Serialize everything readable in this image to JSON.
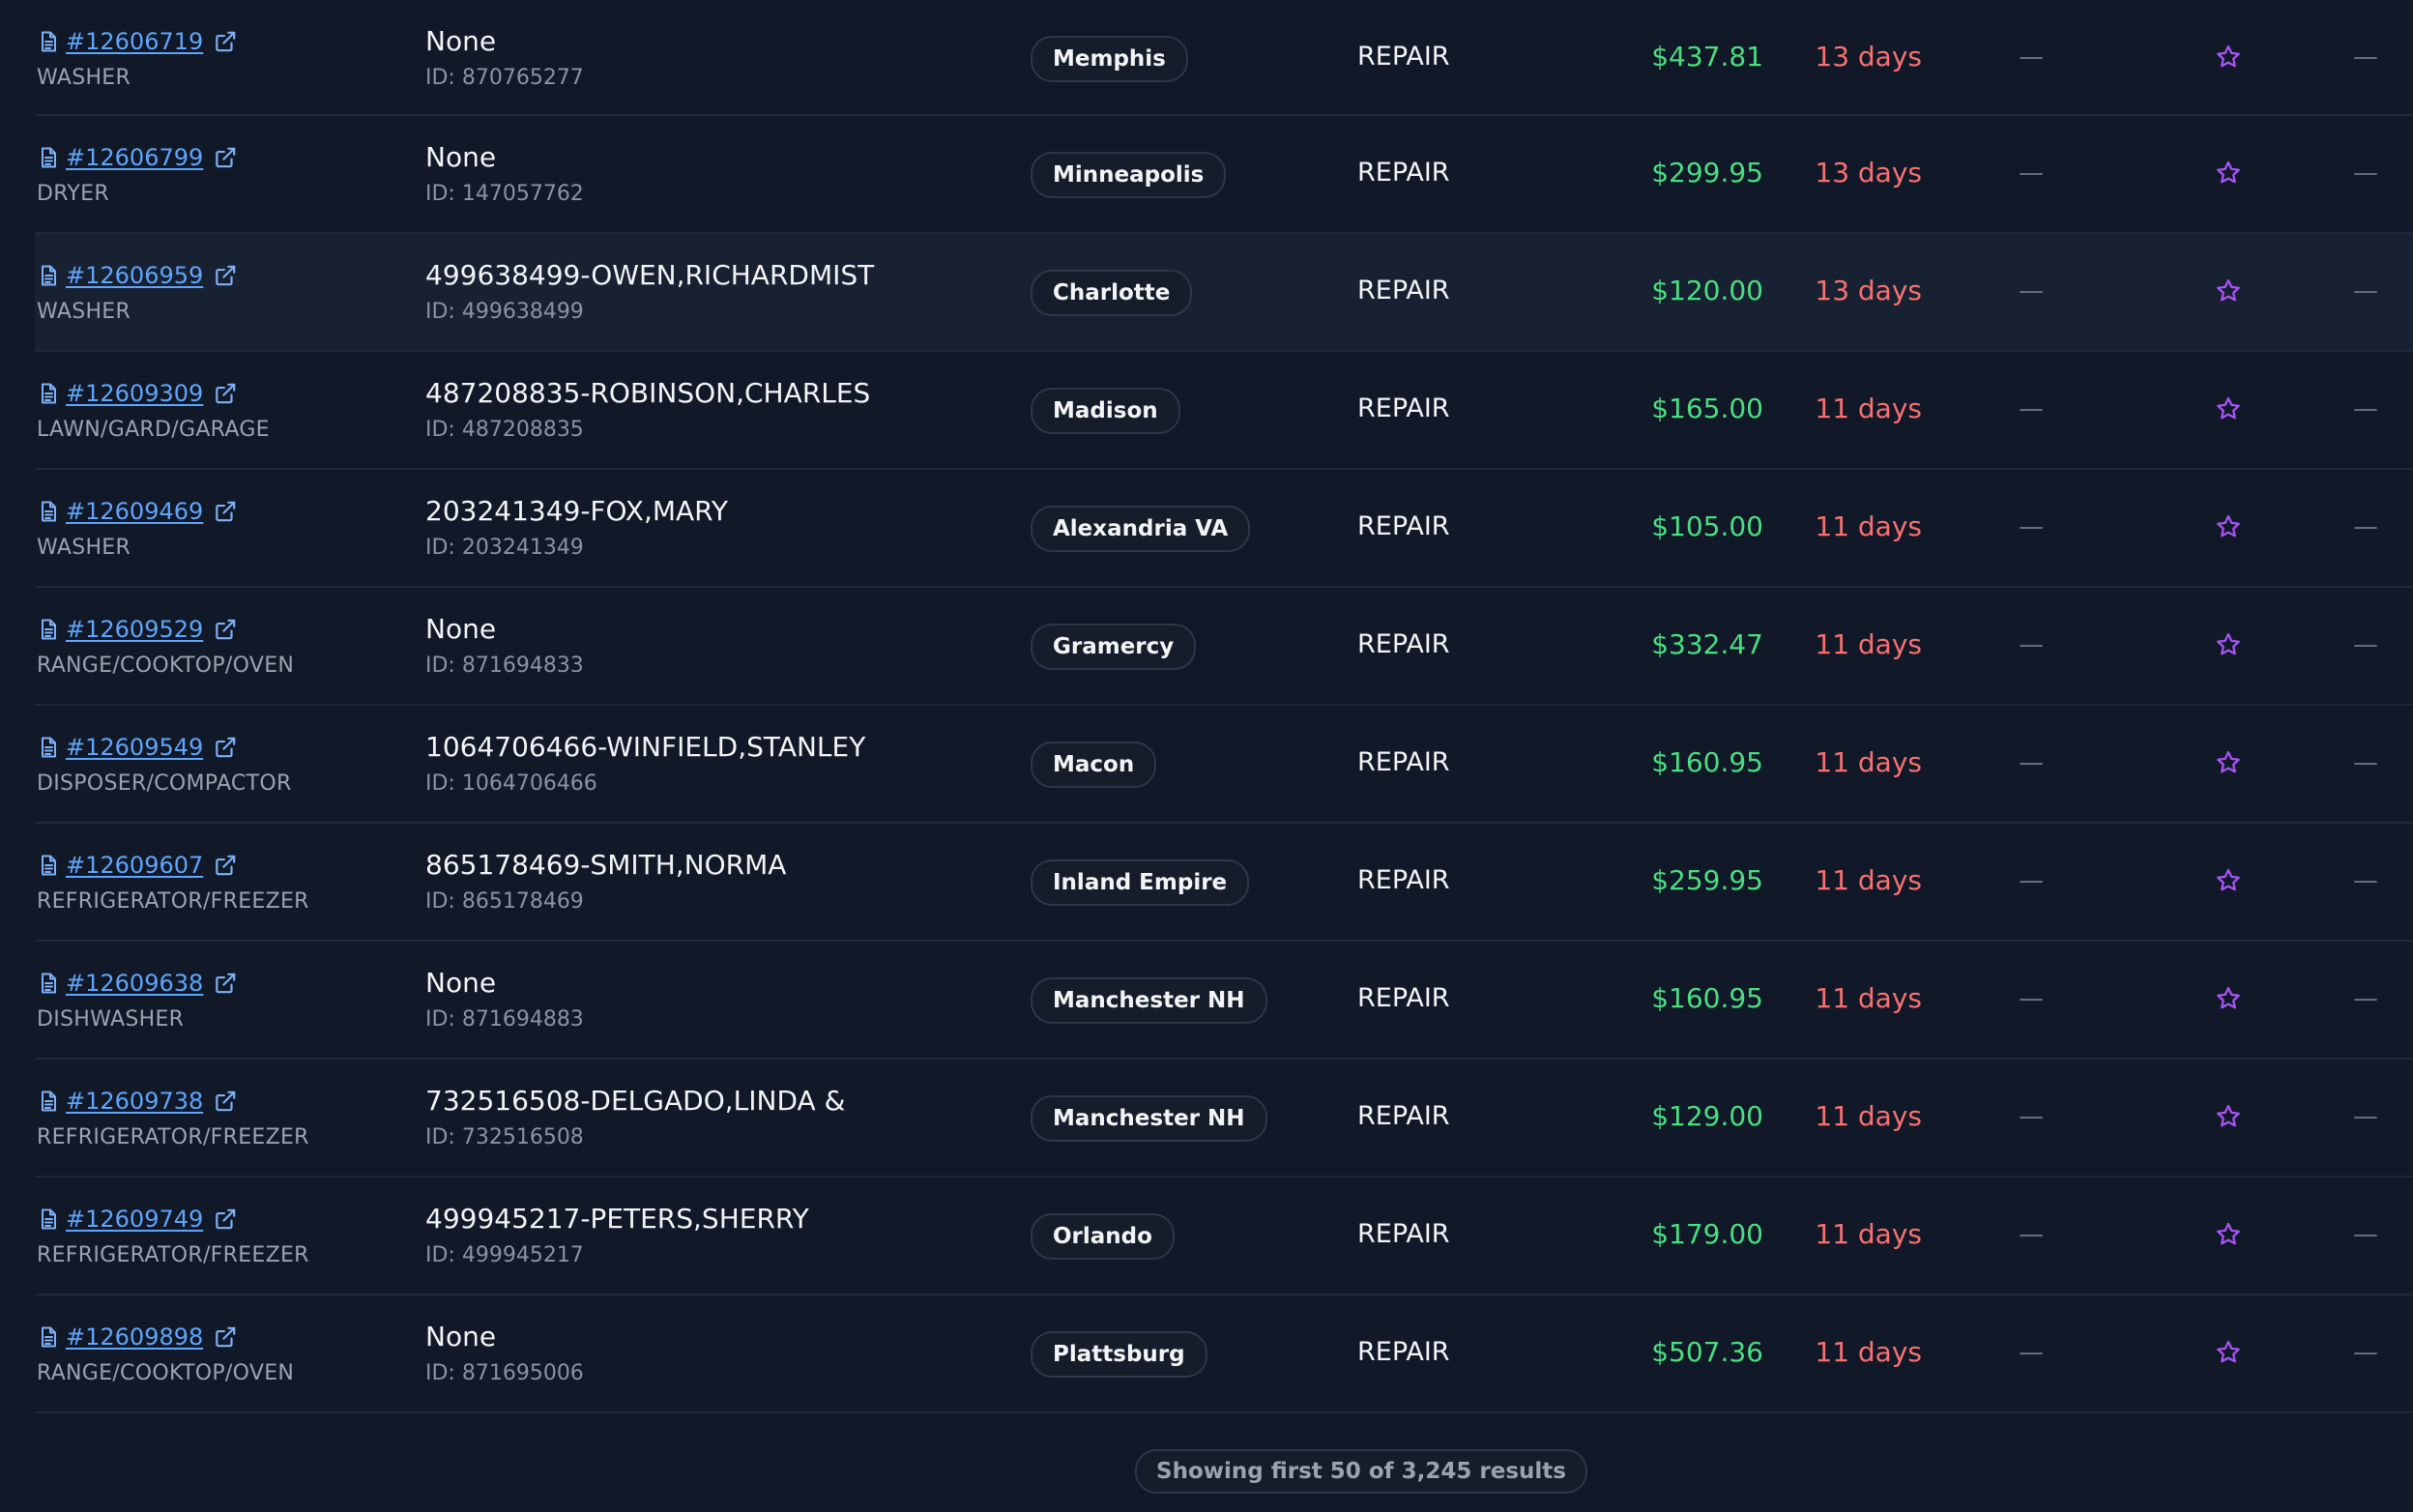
{
  "colors": {
    "background": "#111827",
    "link": "#60a5fa",
    "amount": "#4ade80",
    "age": "#f87171",
    "star": "#a855f7"
  },
  "icons": {
    "order": "document-icon",
    "open": "external-link-icon",
    "favorite": "star-outline-icon"
  },
  "rows": [
    {
      "order": "#12606719",
      "category": "WASHER",
      "customer": "None",
      "customer_id": "ID: 870765277",
      "location": "Memphis",
      "type": "REPAIR",
      "amount": "$437.81",
      "age": "13 days",
      "col1": "—",
      "col2": "—"
    },
    {
      "order": "#12606799",
      "category": "DRYER",
      "customer": "None",
      "customer_id": "ID: 147057762",
      "location": "Minneapolis",
      "type": "REPAIR",
      "amount": "$299.95",
      "age": "13 days",
      "col1": "—",
      "col2": "—"
    },
    {
      "order": "#12606959",
      "category": "WASHER",
      "customer": "499638499-OWEN,RICHARDMIST",
      "customer_id": "ID: 499638499",
      "location": "Charlotte",
      "type": "REPAIR",
      "amount": "$120.00",
      "age": "13 days",
      "col1": "—",
      "col2": "—",
      "highlighted": true
    },
    {
      "order": "#12609309",
      "category": "LAWN/GARD/GARAGE",
      "customer": "487208835-ROBINSON,CHARLES",
      "customer_id": "ID: 487208835",
      "location": "Madison",
      "type": "REPAIR",
      "amount": "$165.00",
      "age": "11 days",
      "col1": "—",
      "col2": "—"
    },
    {
      "order": "#12609469",
      "category": "WASHER",
      "customer": "203241349-FOX,MARY",
      "customer_id": "ID: 203241349",
      "location": "Alexandria VA",
      "type": "REPAIR",
      "amount": "$105.00",
      "age": "11 days",
      "col1": "—",
      "col2": "—"
    },
    {
      "order": "#12609529",
      "category": "RANGE/COOKTOP/OVEN",
      "customer": "None",
      "customer_id": "ID: 871694833",
      "location": "Gramercy",
      "type": "REPAIR",
      "amount": "$332.47",
      "age": "11 days",
      "col1": "—",
      "col2": "—"
    },
    {
      "order": "#12609549",
      "category": "DISPOSER/COMPACTOR",
      "customer": "1064706466-WINFIELD,STANLEY",
      "customer_id": "ID: 1064706466",
      "location": "Macon",
      "type": "REPAIR",
      "amount": "$160.95",
      "age": "11 days",
      "col1": "—",
      "col2": "—"
    },
    {
      "order": "#12609607",
      "category": "REFRIGERATOR/FREEZER",
      "customer": "865178469-SMITH,NORMA",
      "customer_id": "ID: 865178469",
      "location": "Inland Empire",
      "type": "REPAIR",
      "amount": "$259.95",
      "age": "11 days",
      "col1": "—",
      "col2": "—"
    },
    {
      "order": "#12609638",
      "category": "DISHWASHER",
      "customer": "None",
      "customer_id": "ID: 871694883",
      "location": "Manchester NH",
      "type": "REPAIR",
      "amount": "$160.95",
      "age": "11 days",
      "col1": "—",
      "col2": "—"
    },
    {
      "order": "#12609738",
      "category": "REFRIGERATOR/FREEZER",
      "customer": "732516508-DELGADO,LINDA &",
      "customer_id": "ID: 732516508",
      "location": "Manchester NH",
      "type": "REPAIR",
      "amount": "$129.00",
      "age": "11 days",
      "col1": "—",
      "col2": "—"
    },
    {
      "order": "#12609749",
      "category": "REFRIGERATOR/FREEZER",
      "customer": "499945217-PETERS,SHERRY",
      "customer_id": "ID: 499945217",
      "location": "Orlando",
      "type": "REPAIR",
      "amount": "$179.00",
      "age": "11 days",
      "col1": "—",
      "col2": "—"
    },
    {
      "order": "#12609898",
      "category": "RANGE/COOKTOP/OVEN",
      "customer": "None",
      "customer_id": "ID: 871695006",
      "location": "Plattsburg",
      "type": "REPAIR",
      "amount": "$507.36",
      "age": "11 days",
      "col1": "—",
      "col2": "—"
    }
  ],
  "footer": {
    "results_text": "Showing first 50 of 3,245 results"
  }
}
